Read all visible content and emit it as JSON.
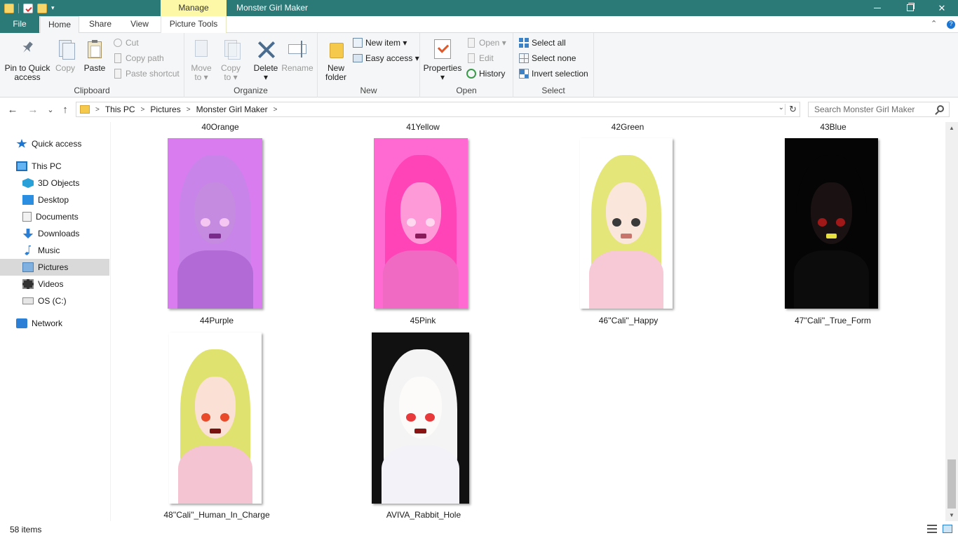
{
  "titlebar": {
    "manage_label": "Manage",
    "window_title": "Monster Girl Maker",
    "minimize_glyph": "",
    "close_glyph": "✕"
  },
  "tabs": {
    "file": "File",
    "home": "Home",
    "share": "Share",
    "view": "View",
    "picture_tools": "Picture Tools",
    "collapse_glyph": "⌃",
    "help_glyph": "?"
  },
  "ribbon": {
    "clipboard": {
      "label": "Clipboard",
      "pin": [
        "Pin to Quick",
        "access"
      ],
      "copy": "Copy",
      "paste": "Paste",
      "cut": "Cut",
      "copy_path": "Copy path",
      "paste_shortcut": "Paste shortcut"
    },
    "organize": {
      "label": "Organize",
      "move_to": [
        "Move",
        "to ▾"
      ],
      "copy_to": [
        "Copy",
        "to ▾"
      ],
      "delete": [
        "Delete",
        "▾"
      ],
      "rename": "Rename"
    },
    "new": {
      "label": "New",
      "new_folder": [
        "New",
        "folder"
      ],
      "new_item": "New item ▾",
      "easy_access": "Easy access ▾"
    },
    "open": {
      "label": "Open",
      "properties": [
        "Properties",
        "▾"
      ],
      "open": "Open ▾",
      "edit": "Edit",
      "history": "History"
    },
    "select": {
      "label": "Select",
      "select_all": "Select all",
      "select_none": "Select none",
      "invert": "Invert selection"
    }
  },
  "address": {
    "back": "←",
    "forward": "→",
    "recent": "⌄",
    "up": "↑",
    "crumbs": [
      "This PC",
      "Pictures",
      "Monster Girl Maker"
    ],
    "sep": ">",
    "dropdown": "⌄",
    "refresh": "↻",
    "search_placeholder": "Search Monster Girl Maker"
  },
  "nav": {
    "items": [
      {
        "label": "Quick access"
      },
      {
        "label": "This PC"
      },
      {
        "label": "3D Objects"
      },
      {
        "label": "Desktop"
      },
      {
        "label": "Documents"
      },
      {
        "label": "Downloads"
      },
      {
        "label": "Music"
      },
      {
        "label": "Pictures"
      },
      {
        "label": "Videos"
      },
      {
        "label": "OS (C:)"
      },
      {
        "label": "Network"
      }
    ]
  },
  "content": {
    "row_top_labels": [
      "40Orange",
      "41Yellow",
      "42Green",
      "43Blue"
    ],
    "files": [
      {
        "name": "44Purple",
        "bg": "#d97cf0",
        "hair": "#c884e8",
        "skin": "#c48be0",
        "body": "#b26ad6",
        "eye": "#f6c6f2",
        "mouth": "#7a2a8a"
      },
      {
        "name": "45Pink",
        "bg": "#ff6ad2",
        "hair": "#ff44b8",
        "skin": "#ff9ad8",
        "body": "#f06ac4",
        "eye": "#ffd8f0",
        "mouth": "#8a1a5a"
      },
      {
        "name": "46''Cali''_Happy",
        "bg": "#ffffff",
        "hair": "#e4e67a",
        "skin": "#fbe6dc",
        "body": "#f7c8d6",
        "eye": "#3a3a3a",
        "mouth": "#c8746a"
      },
      {
        "name": "47''Cali''_True_Form",
        "bg": "#050505",
        "hair": "#050505",
        "skin": "#1a1212",
        "body": "#0c0c0c",
        "eye": "#a01818",
        "mouth": "#e8e040"
      },
      {
        "name": "48''Cali''_Human_In_Charge",
        "bg": "#ffffff",
        "hair": "#e0e270",
        "skin": "#fbe0d6",
        "body": "#f5c4d2",
        "eye": "#e84a2a",
        "mouth": "#7a1010"
      },
      {
        "name": "AVIVA_Rabbit_Hole",
        "bg": "#111111",
        "hair": "#f4f4f4",
        "skin": "#fdfafa",
        "body": "#f2f2f8",
        "eye": "#e83a3a",
        "mouth": "#8a1414"
      }
    ]
  },
  "scroll": {
    "up": "▲",
    "down": "▼"
  },
  "status": {
    "item_count": "58 items"
  }
}
